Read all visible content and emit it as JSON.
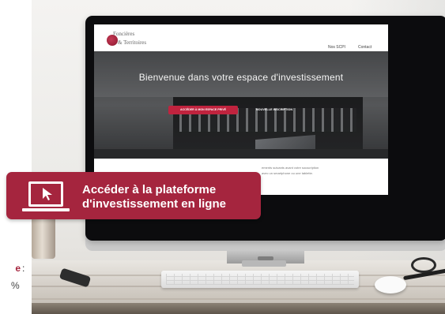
{
  "left_strip": {
    "word_fragment": "e",
    "colon": ":",
    "percent_fragment": "%"
  },
  "website": {
    "logo": {
      "line1": "Foncières",
      "line2": "& Territoires"
    },
    "nav": [
      {
        "label": "Nos SCPI"
      },
      {
        "label": "Contact"
      }
    ],
    "hero": {
      "title": "Bienvenue dans votre espace d'investissement",
      "primary_button": "ACCÉDER À MON ESPACE PRIVÉ",
      "secondary_button": "NOUVELLE INSCRIPTION"
    },
    "intro_text_line1": "ements suivants avant votre souscription",
    "intro_text_line2": "avec un smartphone ou une tablette."
  },
  "cta": {
    "line1": "Accéder à la plateforme",
    "line2": "d'investissement en ligne"
  },
  "colors": {
    "brand": "#a5253e",
    "brand_button": "#c0233e",
    "cta_text": "#ffffff"
  }
}
